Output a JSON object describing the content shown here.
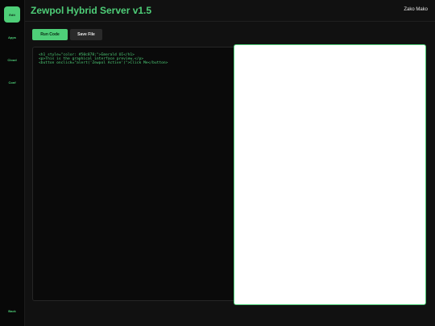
{
  "header": {
    "title": "Zewpol Hybrid Server v1.5",
    "user": "Zako Mako"
  },
  "sidebar": {
    "active": "Edit",
    "items": [
      "Apps",
      "Cloud",
      "Conf"
    ],
    "back": "Back"
  },
  "toolbar": {
    "run_label": "Run Code",
    "save_label": "Save File"
  },
  "editor": {
    "lines": [
      "<h1 style=\"color: #50c878;\">Emerald UI</h1>",
      "<p>This is the graphical interface preview.</p>",
      "<button onclick=\"alert('Zewpol Active')\">Click Me</button>"
    ]
  },
  "colors": {
    "accent": "#4ece78",
    "background": "#111111",
    "sidebar": "#080808",
    "editor": "#0a0a0a",
    "preview": "#ffffff"
  }
}
